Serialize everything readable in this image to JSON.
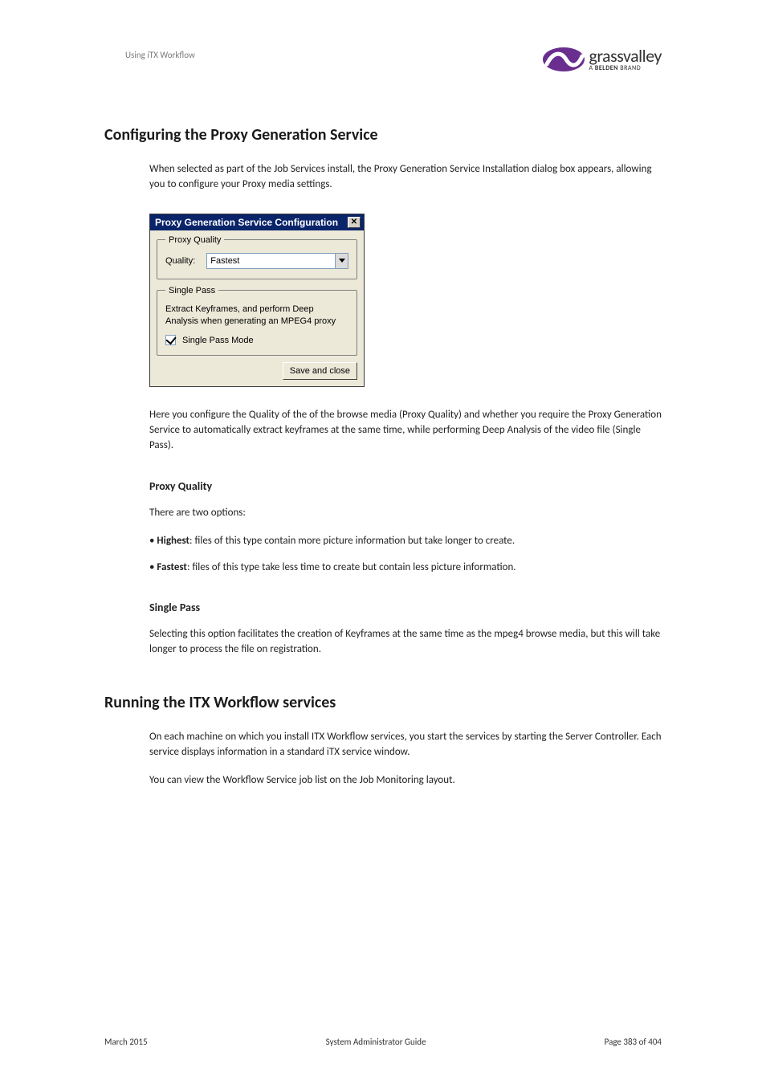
{
  "header": {
    "breadcrumb": "Using iTX Workflow",
    "logo_main": "grassvalley",
    "logo_sub_prefix": "A ",
    "logo_sub_bold": "BELDEN",
    "logo_sub_suffix": " BRAND"
  },
  "section1": {
    "title": "Configuring the Proxy Generation Service",
    "intro": "When selected as part of the Job Services install, the Proxy Generation Service Installation dialog box appears, allowing you to configure your Proxy media settings.",
    "after_dialog": "Here you configure the Quality of the of the browse media (Proxy Quality) and whether you require the Proxy Generation Service to automatically extract keyframes at the same time, while performing Deep Analysis of the video file (Single Pass)."
  },
  "dialog": {
    "title": "Proxy Generation Service Configuration",
    "close_glyph": "✕",
    "group_quality_legend": "Proxy Quality",
    "quality_label": "Quality:",
    "quality_value": "Fastest",
    "group_singlepass_legend": "Single Pass",
    "singlepass_desc": "Extract Keyframes, and perform Deep Analysis when generating an MPEG4 proxy",
    "singlepass_checkbox_label": "Single Pass Mode",
    "save_button": "Save and close"
  },
  "proxy_quality": {
    "heading": "Proxy Quality",
    "intro": "There are two options:",
    "opt1_label": "Highest",
    "opt1_text": ": files of this type contain more picture information but take longer to create.",
    "opt2_label": "Fastest",
    "opt2_text": ": files of this type take less time to create but contain less picture information."
  },
  "single_pass": {
    "heading": "Single Pass",
    "text": "Selecting this option facilitates the creation of Keyframes at the same time as the mpeg4 browse media, but this will take longer to process the file on registration."
  },
  "section2": {
    "title": "Running the ITX Workflow services",
    "p1": "On each machine on which you install ITX Workflow services, you start the services by starting the Server Controller. Each service displays information in a standard iTX service window.",
    "p2": "You can view the Workflow Service job list on the Job Monitoring layout."
  },
  "footer": {
    "left": "March 2015",
    "center": "System Administrator Guide",
    "right": "Page 383 of 404"
  }
}
